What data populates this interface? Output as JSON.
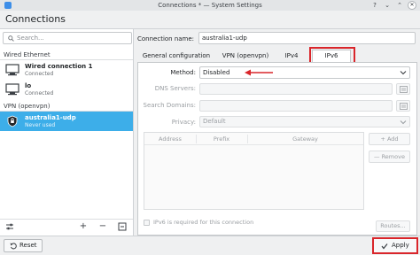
{
  "window": {
    "title": "Connections * — System Settings",
    "help_glyph": "?",
    "minimize_glyph": "⌄",
    "maximize_glyph": "⌃",
    "close_glyph": "✕"
  },
  "page": {
    "title": "Connections"
  },
  "sidebar": {
    "search_placeholder": "Search...",
    "sections": [
      {
        "label": "Wired Ethernet",
        "items": [
          {
            "name": "Wired connection 1",
            "status": "Connected",
            "icon": "ethernet-computer-icon"
          },
          {
            "name": "lo",
            "status": "Connected",
            "icon": "ethernet-computer-icon"
          }
        ]
      },
      {
        "label": "VPN (openvpn)",
        "items": [
          {
            "name": "australia1-udp",
            "status": "Never used",
            "icon": "vpn-shield-icon",
            "selected": true
          }
        ]
      }
    ],
    "toolbar": {
      "add_glyph": "+",
      "remove_glyph": "−"
    }
  },
  "editor": {
    "connection_name_label": "Connection name:",
    "connection_name_value": "australia1-udp",
    "tabs": [
      {
        "label": "General configuration"
      },
      {
        "label": "VPN (openvpn)"
      },
      {
        "label": "IPv4"
      },
      {
        "label": "IPv6",
        "active": true
      }
    ],
    "ipv6": {
      "method_label": "Method:",
      "method_value": "Disabled",
      "dns_label": "DNS Servers:",
      "dns_value": "",
      "search_domains_label": "Search Domains:",
      "search_domains_value": "",
      "privacy_label": "Privacy:",
      "privacy_value": "Default",
      "table_headers": [
        "Address",
        "Prefix",
        "Gateway"
      ],
      "add_label": "+ Add",
      "remove_label": "— Remove",
      "required_label": "IPv6 is required for this connection",
      "routes_label": "Routes..."
    }
  },
  "footer": {
    "reset_label": "Reset",
    "apply_label": "Apply"
  },
  "colors": {
    "accent": "#3daee9",
    "annotation_red": "#d9262b"
  }
}
